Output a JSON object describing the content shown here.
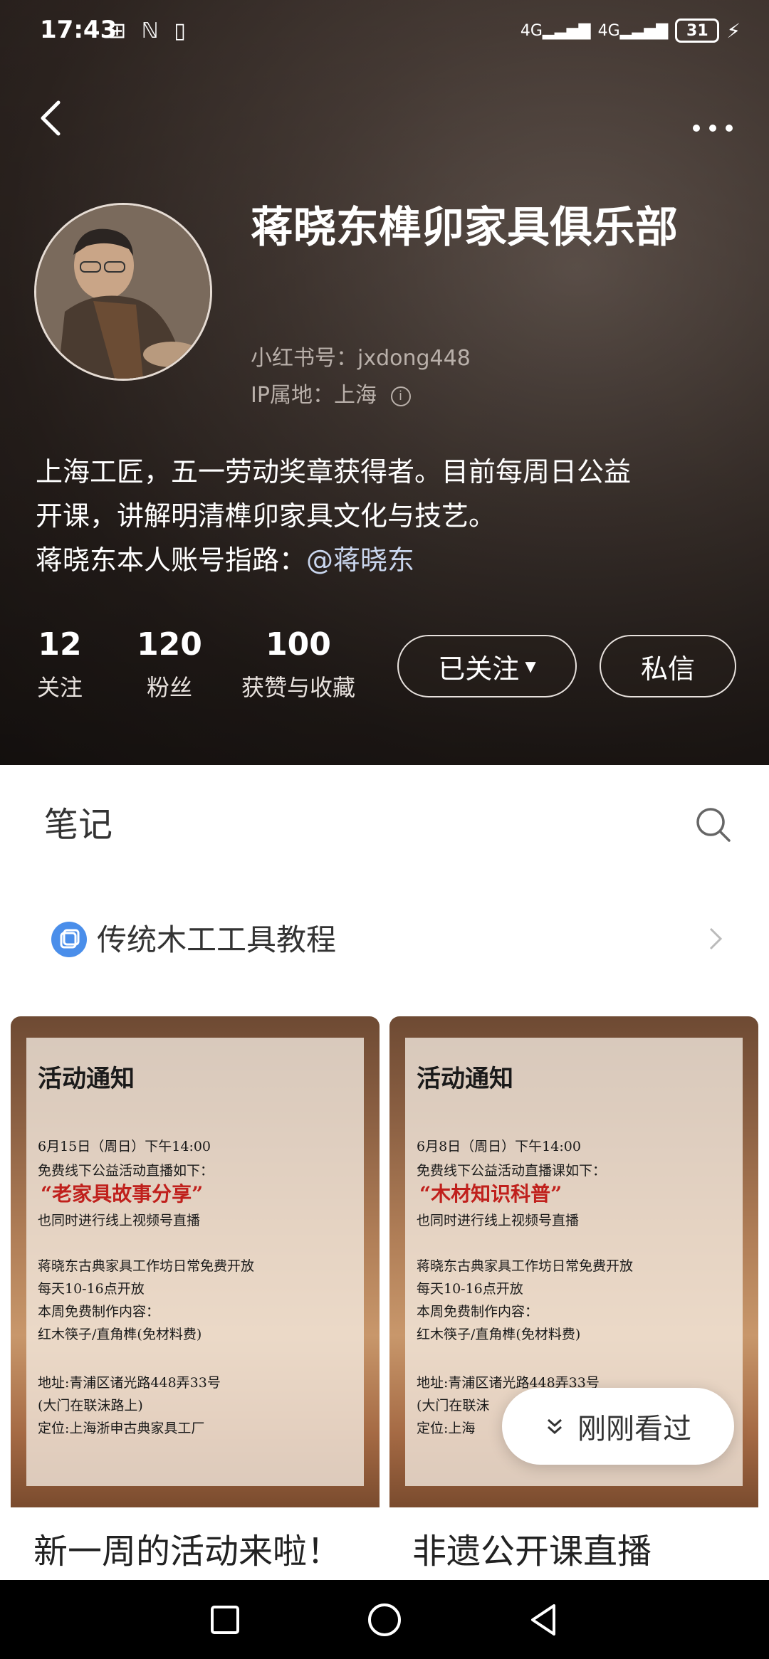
{
  "status_bar": {
    "time": "17:43",
    "left_icons": "⊞ ℕ ▯",
    "signal1": "4G",
    "signal2": "4G",
    "battery": "31"
  },
  "profile": {
    "name": "蒋晓东榫卯家具俱乐部",
    "red_id": "小红书号：jxdong448",
    "ip": "IP属地：上海",
    "bio_line1": "上海工匠，五一劳动奖章获得者。目前每周日公益",
    "bio_line2": "开课，讲解明清榫卯家具文化与技艺。",
    "bio_line3_prefix": "蒋晓东本人账号指路：",
    "bio_mention": "@蒋晓东"
  },
  "stats": [
    {
      "value": "12",
      "label": "关注"
    },
    {
      "value": "120",
      "label": "粉丝"
    },
    {
      "value": "100",
      "label": "获赞与收藏"
    }
  ],
  "buttons": {
    "following": "已关注",
    "message": "私信"
  },
  "notes": {
    "title": "笔记"
  },
  "collection": {
    "label": "传统木工工具教程"
  },
  "cards": [
    {
      "poster_title": "活动通知",
      "line1": "6月15日（周日）下午14:00",
      "line2": "免费线下公益活动直播如下：",
      "highlight": "“老家具故事分享”",
      "line3": "也同时进行线上视频号直播",
      "line4": "蒋晓东古典家具工作坊日常免费开放",
      "line5": "每天10-16点开放",
      "line6": "本周免费制作内容：",
      "line7": "红木筷子/直角榫(免材料费)",
      "line8": "地址:青浦区诸光路448弄33号",
      "line9": "(大门在联沫路上)",
      "line10": "定位:上海浙申古典家具工厂",
      "title": "新一周的活动来啦！"
    },
    {
      "poster_title": "活动通知",
      "line1": "6月8日（周日）下午14:00",
      "line2": "免费线下公益活动直播课如下：",
      "highlight": "“木材知识科普”",
      "line3": "也同时进行线上视频号直播",
      "line4": "蒋晓东古典家具工作坊日常免费开放",
      "line5": "每天10-16点开放",
      "line6": "本周免费制作内容：",
      "line7": "红木筷子/直角榫(免材料费)",
      "line8": "地址:青浦区诸光路448弄33号",
      "line9": "(大门在联沫",
      "line10": "定位:上海",
      "title": "非遗公开课直播"
    }
  ],
  "recently_viewed": "刚刚看过"
}
